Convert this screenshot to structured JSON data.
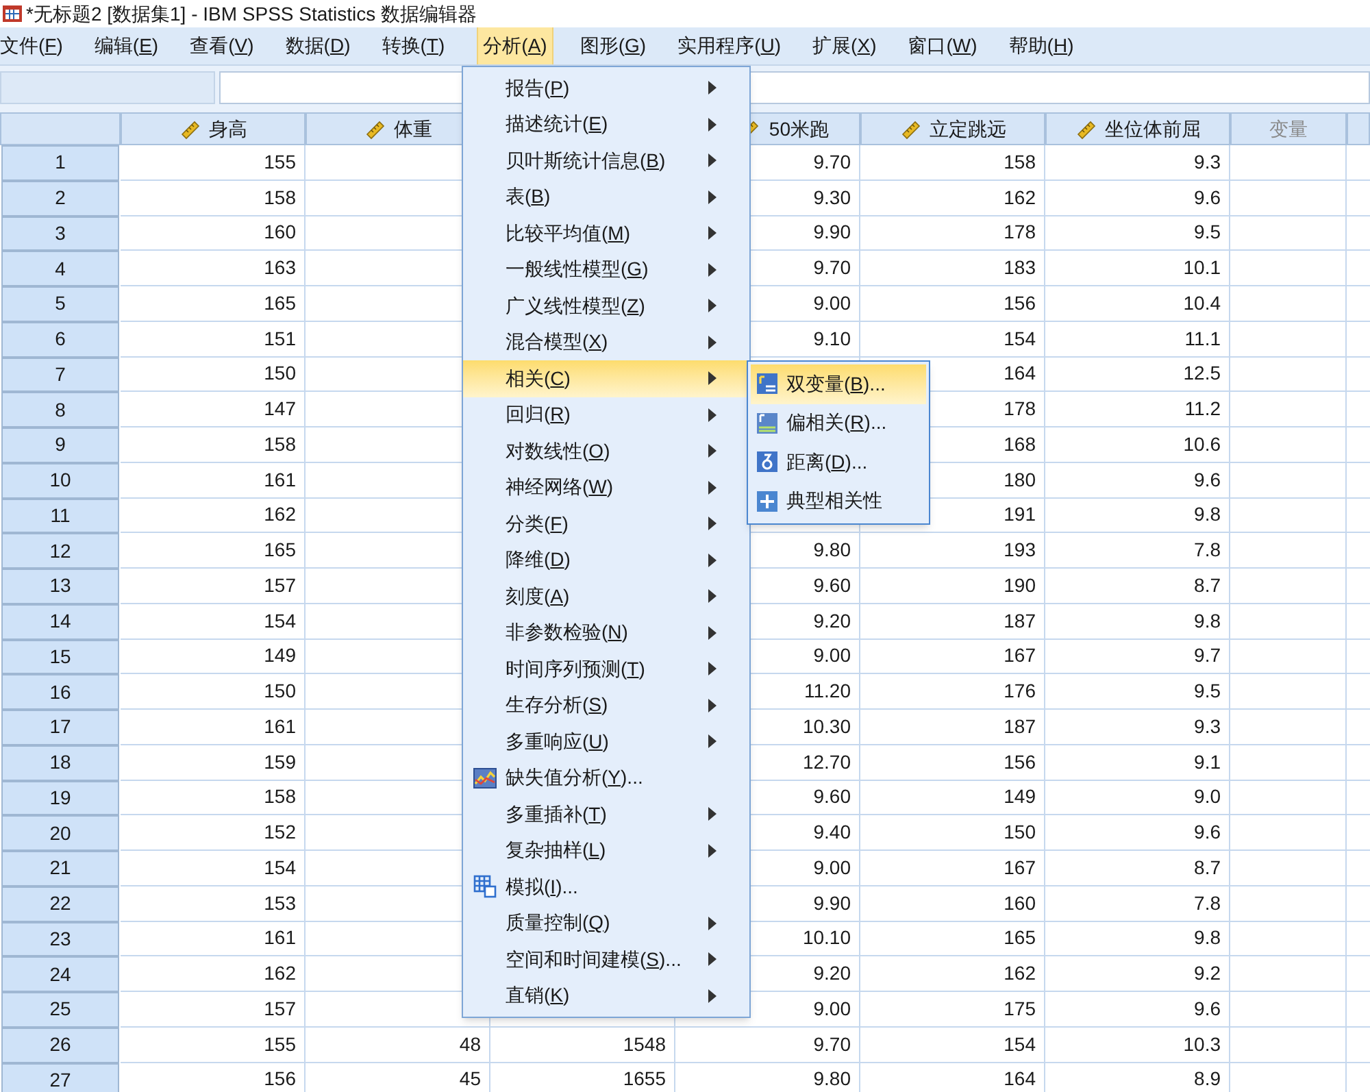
{
  "window": {
    "title": "*无标题2 [数据集1] - IBM SPSS Statistics 数据编辑器"
  },
  "menu_bar": [
    {
      "prefix": "文件(",
      "key": "F",
      "suffix": ")",
      "selected": false
    },
    {
      "prefix": "编辑(",
      "key": "E",
      "suffix": ")",
      "selected": false
    },
    {
      "prefix": "查看(",
      "key": "V",
      "suffix": ")",
      "selected": false
    },
    {
      "prefix": "数据(",
      "key": "D",
      "suffix": ")",
      "selected": false
    },
    {
      "prefix": "转换(",
      "key": "T",
      "suffix": ")",
      "selected": false
    },
    {
      "prefix": "分析(",
      "key": "A",
      "suffix": ")",
      "selected": true
    },
    {
      "prefix": "图形(",
      "key": "G",
      "suffix": ")",
      "selected": false
    },
    {
      "prefix": "实用程序(",
      "key": "U",
      "suffix": ")",
      "selected": false
    },
    {
      "prefix": "扩展(",
      "key": "X",
      "suffix": ")",
      "selected": false
    },
    {
      "prefix": "窗口(",
      "key": "W",
      "suffix": ")",
      "selected": false
    },
    {
      "prefix": "帮助(",
      "key": "H",
      "suffix": ")",
      "selected": false
    }
  ],
  "analyze_menu": [
    {
      "kind": "submenu",
      "prefix": "报告(",
      "key": "P",
      "suffix": ")",
      "selected": false
    },
    {
      "kind": "submenu",
      "prefix": "描述统计(",
      "key": "E",
      "suffix": ")",
      "selected": false
    },
    {
      "kind": "submenu",
      "prefix": "贝叶斯统计信息(",
      "key": "B",
      "suffix": ")",
      "selected": false
    },
    {
      "kind": "submenu",
      "prefix": "表(",
      "key": "B",
      "suffix": ")",
      "selected": false
    },
    {
      "kind": "submenu",
      "prefix": "比较平均值(",
      "key": "M",
      "suffix": ")",
      "selected": false
    },
    {
      "kind": "submenu",
      "prefix": "一般线性模型(",
      "key": "G",
      "suffix": ")",
      "selected": false
    },
    {
      "kind": "submenu",
      "prefix": "广义线性模型(",
      "key": "Z",
      "suffix": ")",
      "selected": false
    },
    {
      "kind": "submenu",
      "prefix": "混合模型(",
      "key": "X",
      "suffix": ")",
      "selected": false
    },
    {
      "kind": "submenu",
      "prefix": "相关(",
      "key": "C",
      "suffix": ")",
      "selected": true
    },
    {
      "kind": "submenu",
      "prefix": "回归(",
      "key": "R",
      "suffix": ")",
      "selected": false
    },
    {
      "kind": "submenu",
      "prefix": "对数线性(",
      "key": "O",
      "suffix": ")",
      "selected": false
    },
    {
      "kind": "submenu",
      "prefix": "神经网络(",
      "key": "W",
      "suffix": ")",
      "selected": false
    },
    {
      "kind": "submenu",
      "prefix": "分类(",
      "key": "F",
      "suffix": ")",
      "selected": false
    },
    {
      "kind": "submenu",
      "prefix": "降维(",
      "key": "D",
      "suffix": ")",
      "selected": false
    },
    {
      "kind": "submenu",
      "prefix": "刻度(",
      "key": "A",
      "suffix": ")",
      "selected": false
    },
    {
      "kind": "submenu",
      "prefix": "非参数检验(",
      "key": "N",
      "suffix": ")",
      "selected": false
    },
    {
      "kind": "submenu",
      "prefix": "时间序列预测(",
      "key": "T",
      "suffix": ")",
      "selected": false
    },
    {
      "kind": "submenu",
      "prefix": "生存分析(",
      "key": "S",
      "suffix": ")",
      "selected": false
    },
    {
      "kind": "submenu",
      "prefix": "多重响应(",
      "key": "U",
      "suffix": ")",
      "selected": false
    },
    {
      "kind": "missing",
      "prefix": "缺失值分析(",
      "key": "Y",
      "suffix": ")...",
      "selected": false
    },
    {
      "kind": "submenu",
      "prefix": "多重插补(",
      "key": "T",
      "suffix": ")",
      "selected": false
    },
    {
      "kind": "submenu",
      "prefix": "复杂抽样(",
      "key": "L",
      "suffix": ")",
      "selected": false
    },
    {
      "kind": "simulation",
      "prefix": "模拟(",
      "key": "I",
      "suffix": ")...",
      "selected": false
    },
    {
      "kind": "submenu",
      "prefix": "质量控制(",
      "key": "Q",
      "suffix": ")",
      "selected": false
    },
    {
      "kind": "submenu",
      "prefix": "空间和时间建模(",
      "key": "S",
      "suffix": ")...",
      "selected": false
    },
    {
      "kind": "submenu",
      "prefix": "直销(",
      "key": "K",
      "suffix": ")",
      "selected": false
    }
  ],
  "correlate_submenu": [
    {
      "kind": "bivariate",
      "prefix": "双变量(",
      "key": "B",
      "suffix": ")...",
      "selected": true
    },
    {
      "kind": "partial",
      "prefix": "偏相关(",
      "key": "R",
      "suffix": ")...",
      "selected": false
    },
    {
      "kind": "distance",
      "prefix": "距离(",
      "key": "D",
      "suffix": ")...",
      "selected": false
    },
    {
      "kind": "canonical",
      "prefix": "典型相关性",
      "selected": false
    }
  ],
  "table": {
    "columns": [
      {
        "label": "身高",
        "kind": "scale"
      },
      {
        "label": "体重",
        "kind": "scale"
      },
      {
        "kind": "hidden"
      },
      {
        "label": "50米跑",
        "kind": "scale_covered"
      },
      {
        "label": "立定跳远",
        "kind": "scale"
      },
      {
        "label": "坐位体前屈",
        "kind": "scale"
      },
      {
        "label": "变量",
        "kind": "empty"
      }
    ],
    "rows": [
      {
        "number": "1",
        "cells": [
          "155",
          null,
          null,
          "9.70",
          "158",
          "9.3",
          null
        ]
      },
      {
        "number": "2",
        "cells": [
          "158",
          null,
          null,
          "9.30",
          "162",
          "9.6",
          null
        ]
      },
      {
        "number": "3",
        "cells": [
          "160",
          null,
          null,
          "9.90",
          "178",
          "9.5",
          null
        ]
      },
      {
        "number": "4",
        "cells": [
          "163",
          null,
          null,
          "9.70",
          "183",
          "10.1",
          null
        ]
      },
      {
        "number": "5",
        "cells": [
          "165",
          null,
          null,
          "9.00",
          "156",
          "10.4",
          null
        ]
      },
      {
        "number": "6",
        "cells": [
          "151",
          null,
          null,
          "9.10",
          "154",
          "11.1",
          null
        ]
      },
      {
        "number": "7",
        "cells": [
          "150",
          null,
          null,
          null,
          "164",
          "12.5",
          null
        ]
      },
      {
        "number": "8",
        "cells": [
          "147",
          null,
          null,
          null,
          "178",
          "11.2",
          null
        ]
      },
      {
        "number": "9",
        "cells": [
          "158",
          null,
          null,
          null,
          "168",
          "10.6",
          null
        ]
      },
      {
        "number": "10",
        "cells": [
          "161",
          null,
          null,
          null,
          "180",
          "9.6",
          null
        ]
      },
      {
        "number": "11",
        "cells": [
          "162",
          null,
          null,
          null,
          "191",
          "9.8",
          null
        ]
      },
      {
        "number": "12",
        "cells": [
          "165",
          null,
          null,
          "9.80",
          "193",
          "7.8",
          null
        ]
      },
      {
        "number": "13",
        "cells": [
          "157",
          null,
          null,
          "9.60",
          "190",
          "8.7",
          null
        ]
      },
      {
        "number": "14",
        "cells": [
          "154",
          null,
          null,
          "9.20",
          "187",
          "9.8",
          null
        ]
      },
      {
        "number": "15",
        "cells": [
          "149",
          null,
          null,
          "9.00",
          "167",
          "9.7",
          null
        ]
      },
      {
        "number": "16",
        "cells": [
          "150",
          null,
          null,
          "11.20",
          "176",
          "9.5",
          null
        ]
      },
      {
        "number": "17",
        "cells": [
          "161",
          null,
          null,
          "10.30",
          "187",
          "9.3",
          null
        ]
      },
      {
        "number": "18",
        "cells": [
          "159",
          null,
          null,
          "12.70",
          "156",
          "9.1",
          null
        ]
      },
      {
        "number": "19",
        "cells": [
          "158",
          null,
          null,
          "9.60",
          "149",
          "9.0",
          null
        ]
      },
      {
        "number": "20",
        "cells": [
          "152",
          null,
          null,
          "9.40",
          "150",
          "9.6",
          null
        ]
      },
      {
        "number": "21",
        "cells": [
          "154",
          null,
          null,
          "9.00",
          "167",
          "8.7",
          null
        ]
      },
      {
        "number": "22",
        "cells": [
          "153",
          null,
          null,
          "9.90",
          "160",
          "7.8",
          null
        ]
      },
      {
        "number": "23",
        "cells": [
          "161",
          null,
          null,
          "10.10",
          "165",
          "9.8",
          null
        ]
      },
      {
        "number": "24",
        "cells": [
          "162",
          null,
          null,
          "9.20",
          "162",
          "9.2",
          null
        ]
      },
      {
        "number": "25",
        "cells": [
          "157",
          null,
          null,
          "9.00",
          "175",
          "9.6",
          null
        ]
      },
      {
        "number": "26",
        "cells": [
          "155",
          "48",
          "1548",
          "9.70",
          "154",
          "10.3",
          null
        ]
      },
      {
        "number": "27",
        "cells": [
          "156",
          "45",
          "1655",
          "9.80",
          "164",
          "8.9",
          null
        ]
      }
    ]
  }
}
